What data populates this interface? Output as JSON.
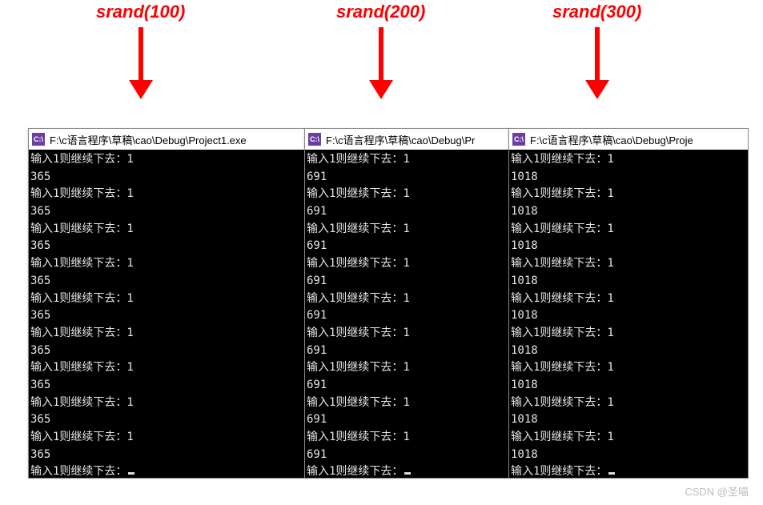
{
  "labels": {
    "l1": "srand(100)",
    "l2": "srand(200)",
    "l3": "srand(300)"
  },
  "icon_text": "C:\\",
  "consoles": [
    {
      "title": "F:\\c语言程序\\草稿\\cao\\Debug\\Project1.exe",
      "prompt": "输入1则继续下去：",
      "input": "1",
      "value": "365",
      "repeat": 9
    },
    {
      "title": "F:\\c语言程序\\草稿\\cao\\Debug\\Pr",
      "prompt": "输入1则继续下去：",
      "input": "1",
      "value": "691",
      "repeat": 9
    },
    {
      "title": "F:\\c语言程序\\草稿\\cao\\Debug\\Proje",
      "prompt": "输入1则继续下去：",
      "input": "1",
      "value": "1018",
      "repeat": 9
    }
  ],
  "watermark": "CSDN @圣喵"
}
